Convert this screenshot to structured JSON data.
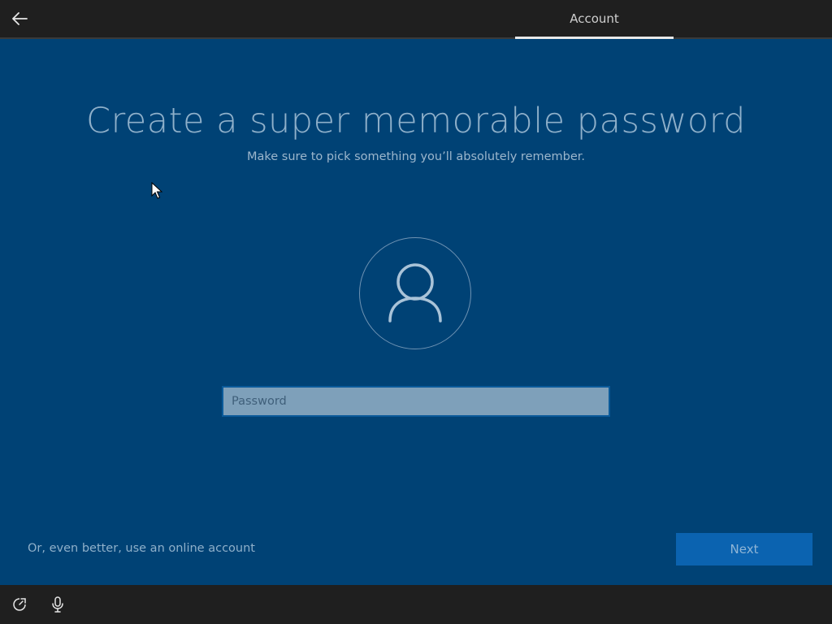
{
  "header": {
    "tabs": [
      {
        "label": "Account",
        "active": true
      }
    ]
  },
  "main": {
    "title": "Create a super memorable password",
    "subtitle": "Make sure to pick something you’ll absolutely remember.",
    "password": {
      "placeholder": "Password",
      "value": ""
    }
  },
  "footer": {
    "online_link": "Or, even better, use an online account",
    "next_label": "Next"
  },
  "icons": {
    "back": "arrow-left-icon",
    "avatar": "user-icon",
    "accessibility": "ease-of-access-icon",
    "microphone": "microphone-icon"
  },
  "colors": {
    "background": "#004275",
    "topbar": "#1f1f1f",
    "accent_button": "#0b63b0",
    "input_bg": "#7ea0ba"
  }
}
